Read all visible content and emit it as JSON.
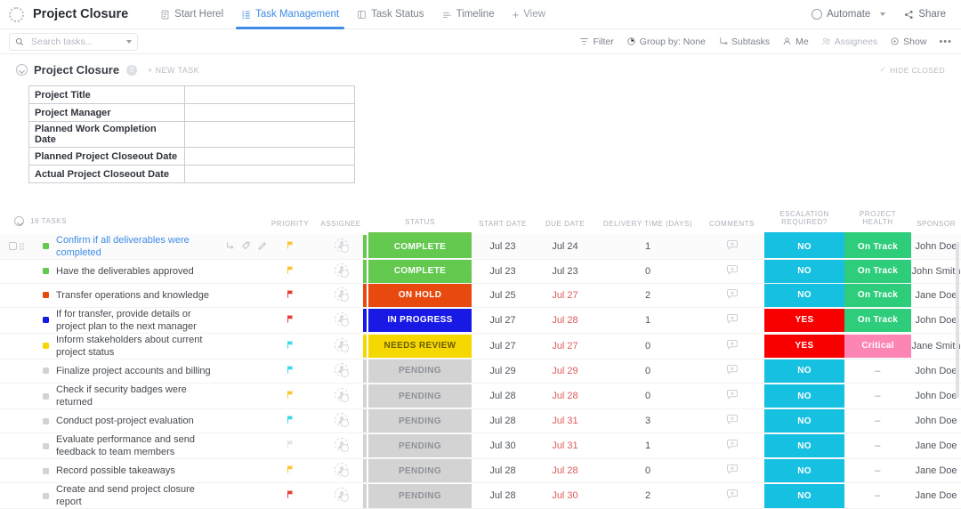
{
  "header": {
    "logo_icon": "clickup-dots-icon",
    "space_title": "Project Closure",
    "views": [
      {
        "label": "Start Herel",
        "icon": "doc-icon",
        "active": false
      },
      {
        "label": "Task Management",
        "icon": "list-icon",
        "active": true
      },
      {
        "label": "Task Status",
        "icon": "board-icon",
        "active": false
      },
      {
        "label": "Timeline",
        "icon": "timeline-icon",
        "active": false
      }
    ],
    "add_view_label": "View",
    "add_view_icon": "plus-icon",
    "automate_label": "Automate",
    "automate_icon": "robot-icon",
    "automate_caret_icon": "chevron-down-icon",
    "share_label": "Share",
    "share_icon": "share-icon"
  },
  "toolbar": {
    "search_placeholder": "Search tasks...",
    "search_value": "",
    "search_icon": "search-icon",
    "search_caret_icon": "chevron-down-icon",
    "items": [
      {
        "label": "Filter",
        "icon": "filter-icon",
        "muted": false
      },
      {
        "label": "Group by: None",
        "icon": "group-icon",
        "muted": false
      },
      {
        "label": "Subtasks",
        "icon": "subtask-icon",
        "muted": false
      },
      {
        "label": "Me",
        "icon": "person-icon",
        "muted": false
      },
      {
        "label": "Assignees",
        "icon": "people-icon",
        "muted": true
      },
      {
        "label": "Show",
        "icon": "eye-icon",
        "muted": false
      },
      {
        "label": "•••",
        "icon": "more-icon",
        "muted": false
      }
    ]
  },
  "group": {
    "chevron_icon": "chevron-circle-icon",
    "title": "Project Closure",
    "count": "0",
    "new_task_label": "+ NEW TASK",
    "hide_closed_label": "HIDE CLOSED",
    "hide_closed_icon": "check-icon"
  },
  "doc_table": {
    "rows": [
      {
        "key": "Project Title",
        "value": ""
      },
      {
        "key": "Project Manager",
        "value": ""
      },
      {
        "key": "Planned Work Completion Date",
        "value": ""
      },
      {
        "key": "Planned Project Closeout Date",
        "value": ""
      },
      {
        "key": "Actual Project Closeout Date",
        "value": ""
      }
    ]
  },
  "task_grid": {
    "select_all_icon": "chevron-circle-icon",
    "task_count_label": "16 TASKS",
    "columns": [
      "PRIORITY",
      "ASSIGNEE",
      "STATUS",
      "START DATE",
      "DUE DATE",
      "DELIVERY TIME (DAYS)",
      "COMMENTS",
      "ESCALATION REQUIRED?",
      "PROJECT HEALTH",
      "SPONSOR"
    ],
    "colors": {
      "complete": "#63ca4f",
      "on_hold": "#e8490f",
      "in_progress": "#1919e6",
      "needs_review": "#f5d800",
      "pending": "#d3d3d3",
      "escalation_no": "#16c0e0",
      "escalation_yes": "#f90000",
      "health_on_track": "#2ecd7b",
      "health_critical": "#fc85b4",
      "accent": "#3e8ce6"
    },
    "rows": [
      {
        "name": "Confirm if all deliverables were completed",
        "dot": "#63ca4f",
        "priority": "yellow",
        "status": "COMPLETE",
        "status_color": "#63ca4f",
        "start": "Jul 23",
        "due": "Jul 24",
        "due_late": false,
        "delivery": "1",
        "escalation": "NO",
        "escalation_color": "#16c0e0",
        "health": "On Track",
        "health_color": "#2ecd7b",
        "sponsor": "John Doe",
        "hovered": true
      },
      {
        "name": "Have the deliverables approved",
        "dot": "#63ca4f",
        "priority": "yellow",
        "status": "COMPLETE",
        "status_color": "#63ca4f",
        "start": "Jul 23",
        "due": "Jul 23",
        "due_late": false,
        "delivery": "0",
        "escalation": "NO",
        "escalation_color": "#16c0e0",
        "health": "On Track",
        "health_color": "#2ecd7b",
        "sponsor": "John Smith",
        "hovered": false
      },
      {
        "name": "Transfer operations and knowledge",
        "dot": "#e8490f",
        "priority": "red",
        "status": "ON HOLD",
        "status_color": "#e8490f",
        "start": "Jul 25",
        "due": "Jul 27",
        "due_late": true,
        "delivery": "2",
        "escalation": "NO",
        "escalation_color": "#16c0e0",
        "health": "On Track",
        "health_color": "#2ecd7b",
        "sponsor": "Jane Doe",
        "hovered": false
      },
      {
        "name": "If for transfer, provide details or project plan to the next manager",
        "dot": "#1919e6",
        "priority": "red",
        "status": "IN PROGRESS",
        "status_color": "#1919e6",
        "start": "Jul 27",
        "due": "Jul 28",
        "due_late": true,
        "delivery": "1",
        "escalation": "YES",
        "escalation_color": "#f90000",
        "health": "On Track",
        "health_color": "#2ecd7b",
        "sponsor": "John Doe",
        "hovered": false
      },
      {
        "name": "Inform stakeholders about current project status",
        "dot": "#f5d800",
        "priority": "cyan",
        "status": "NEEDS REVIEW",
        "status_color": "#f5d800",
        "start": "Jul 27",
        "due": "Jul 27",
        "due_late": true,
        "delivery": "0",
        "escalation": "YES",
        "escalation_color": "#f90000",
        "health": "Critical",
        "health_color": "#fc85b4",
        "sponsor": "Jane Smith",
        "hovered": false
      },
      {
        "name": "Finalize project accounts and billing",
        "dot": "#d3d3d3",
        "priority": "cyan",
        "status": "PENDING",
        "status_color": "#d3d3d3",
        "start": "Jul 29",
        "due": "Jul 29",
        "due_late": true,
        "delivery": "0",
        "escalation": "NO",
        "escalation_color": "#16c0e0",
        "health": "–",
        "health_color": "",
        "sponsor": "John Doe",
        "hovered": false
      },
      {
        "name": "Check if security badges were returned",
        "dot": "#d3d3d3",
        "priority": "yellow",
        "status": "PENDING",
        "status_color": "#d3d3d3",
        "start": "Jul 28",
        "due": "Jul 28",
        "due_late": true,
        "delivery": "0",
        "escalation": "NO",
        "escalation_color": "#16c0e0",
        "health": "–",
        "health_color": "",
        "sponsor": "John Doe",
        "hovered": false
      },
      {
        "name": "Conduct post-project evaluation",
        "dot": "#d3d3d3",
        "priority": "cyan",
        "status": "PENDING",
        "status_color": "#d3d3d3",
        "start": "Jul 28",
        "due": "Jul 31",
        "due_late": true,
        "delivery": "3",
        "escalation": "NO",
        "escalation_color": "#16c0e0",
        "health": "–",
        "health_color": "",
        "sponsor": "John Doe",
        "hovered": false
      },
      {
        "name": "Evaluate performance and send feedback to team members",
        "dot": "#d3d3d3",
        "priority": "grey",
        "status": "PENDING",
        "status_color": "#d3d3d3",
        "start": "Jul 30",
        "due": "Jul 31",
        "due_late": true,
        "delivery": "1",
        "escalation": "NO",
        "escalation_color": "#16c0e0",
        "health": "–",
        "health_color": "",
        "sponsor": "Jane Doe",
        "hovered": false
      },
      {
        "name": "Record possible takeaways",
        "dot": "#d3d3d3",
        "priority": "yellow",
        "status": "PENDING",
        "status_color": "#d3d3d3",
        "start": "Jul 28",
        "due": "Jul 28",
        "due_late": true,
        "delivery": "0",
        "escalation": "NO",
        "escalation_color": "#16c0e0",
        "health": "–",
        "health_color": "",
        "sponsor": "Jane Doe",
        "hovered": false
      },
      {
        "name": "Create and send project closure report",
        "dot": "#d3d3d3",
        "priority": "red",
        "status": "PENDING",
        "status_color": "#d3d3d3",
        "start": "Jul 28",
        "due": "Jul 30",
        "due_late": true,
        "delivery": "2",
        "escalation": "NO",
        "escalation_color": "#16c0e0",
        "health": "–",
        "health_color": "",
        "sponsor": "Jane Doe",
        "hovered": false
      }
    ]
  }
}
